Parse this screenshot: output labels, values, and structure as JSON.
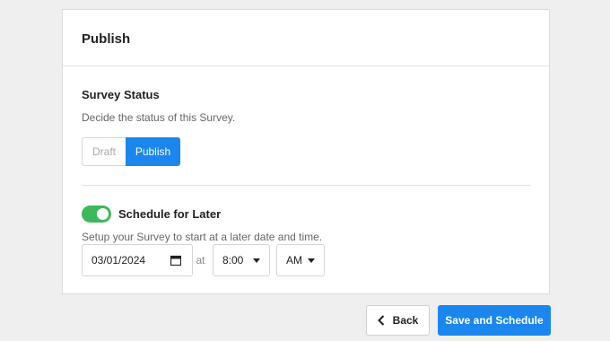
{
  "panel": {
    "title": "Publish"
  },
  "survey_status": {
    "title": "Survey Status",
    "description": "Decide the status of this Survey.",
    "options": [
      "Draft",
      "Publish"
    ],
    "selected": "Publish"
  },
  "schedule": {
    "label": "Schedule for Later",
    "enabled": true,
    "description": "Setup your Survey to start at a later date and time.",
    "date_value": "03/01/2024",
    "at_label": "at",
    "time_value": "8:00",
    "ampm_value": "AM"
  },
  "footer": {
    "back_label": "Back",
    "save_label": "Save and Schedule"
  },
  "colors": {
    "accent": "#1b87ee",
    "toggle_on": "#3db85a"
  },
  "icons": {
    "back": "chevron-left-icon",
    "date": "calendar-icon",
    "time_dropdown": "caret-down-icon",
    "ampm_dropdown": "caret-down-icon"
  }
}
